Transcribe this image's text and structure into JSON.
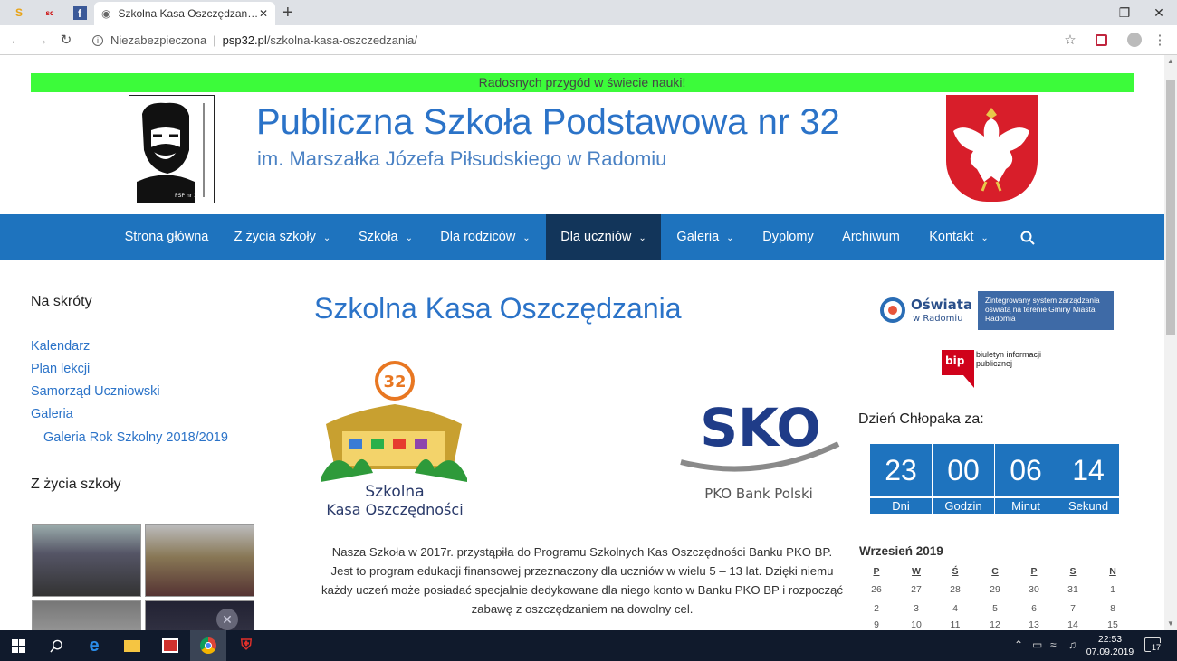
{
  "browser": {
    "tab_title": "Szkolna Kasa Oszczędzania – Pu",
    "security_label": "Niezabezpieczona",
    "url_domain": "psp32.pl",
    "url_path": "/szkolna-kasa-oszczedzania/"
  },
  "site": {
    "motto": "Radosnych przygód w świecie nauki!",
    "title": "Publiczna Szkoła Podstawowa nr 32",
    "subtitle": "im. Marszałka Józefa Piłsudskiego w Radomiu"
  },
  "nav": {
    "items": [
      {
        "label": "Strona główna"
      },
      {
        "label": "Z życia szkoły"
      },
      {
        "label": "Szkoła"
      },
      {
        "label": "Dla rodziców"
      },
      {
        "label": "Dla uczniów"
      },
      {
        "label": "Galeria"
      },
      {
        "label": "Dyplomy"
      },
      {
        "label": "Archiwum"
      },
      {
        "label": "Kontakt"
      }
    ]
  },
  "sidebar": {
    "shortcuts_heading": "Na skróty",
    "links": [
      "Kalendarz",
      "Plan lekcji",
      "Samorząd Uczniowski",
      "Galeria",
      "Galeria Rok Szkolny 2018/2019"
    ],
    "life_heading": "Z życia szkoły"
  },
  "main": {
    "page_title": "Szkolna Kasa Oszczędzania",
    "article_lines": [
      "Nasza Szkoła w 2017r. przystąpiła do Programu Szkolnych Kas Oszczędności Banku PKO BP.",
      "Jest to program edukacji finansowej przeznaczony dla uczniów w wielu 5 – 13 lat. Dzięki niemu",
      "każdy uczeń może posiadać specjalnie dedykowane dla niego konto w Banku PKO BP i rozpocząć",
      "zabawę z oszczędzaniem na dowolny cel."
    ],
    "logo_left_number": "32",
    "logo_left_line1": "Szkolna",
    "logo_left_line2": "Kasa Oszczędności",
    "logo_right_mark": "SKO",
    "logo_right_bank": "PKO Bank Polski"
  },
  "right": {
    "oswiata_title": "Oświata",
    "oswiata_sub": "w Radomiu",
    "oswiata_box": "Zintegrowany system zarządzania oświatą na terenie Gminy Miasta Radomia",
    "bip_mark": "bip",
    "bip_text": "biuletyn informacji publicznej",
    "countdown_label": "Dzień Chłopaka za:",
    "countdown": [
      {
        "value": "23",
        "unit": "Dni"
      },
      {
        "value": "00",
        "unit": "Godzin"
      },
      {
        "value": "06",
        "unit": "Minut"
      },
      {
        "value": "14",
        "unit": "Sekund"
      }
    ],
    "calendar_title": "Wrzesień 2019",
    "calendar_headers": [
      "P",
      "W",
      "Ś",
      "C",
      "P",
      "S",
      "N"
    ],
    "calendar_rows": [
      [
        "26",
        "27",
        "28",
        "29",
        "30",
        "31",
        "1"
      ],
      [
        "2",
        "3",
        "4",
        "5",
        "6",
        "7",
        "8"
      ],
      [
        "9",
        "10",
        "11",
        "12",
        "13",
        "14",
        "15"
      ]
    ]
  },
  "taskbar": {
    "time": "22:53",
    "date": "07.09.2019",
    "notifications": "17"
  }
}
